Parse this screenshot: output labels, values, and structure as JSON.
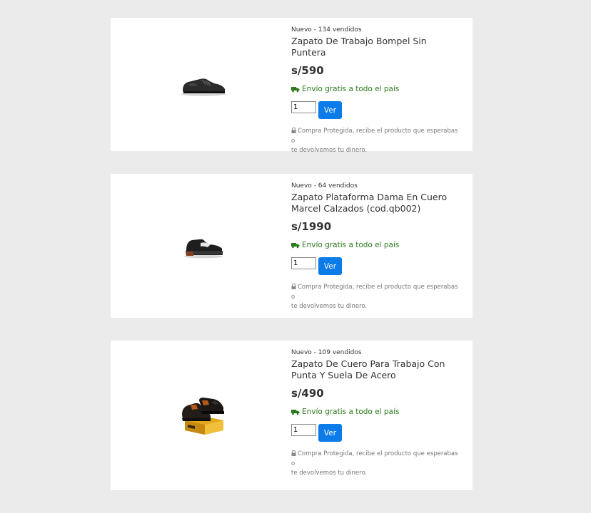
{
  "products": [
    {
      "meta": "Nuevo - 134 vendidos",
      "title_line1": "Zapato De Trabajo Bompel Sin Puntera",
      "title_line2": "",
      "price": "s/590",
      "shipping": "Envío gratis a todo el país",
      "qty": "1",
      "button": "Ver",
      "protect_line1": "Compra Protegida, recibe el producto que esperabas o",
      "protect_line2": "te devolvemos tu dinero.",
      "image": "black-work-shoe"
    },
    {
      "meta": "Nuevo - 64 vendidos",
      "title_line1": "Zapato Plataforma Dama En Cuero",
      "title_line2": "Marcel Calzados (cod.qb002)",
      "price": "s/1990",
      "shipping": "Envío gratis a todo el país",
      "qty": "1",
      "button": "Ver",
      "protect_line1": "Compra Protegida, recibe el producto que esperabas o",
      "protect_line2": "te devolvemos tu dinero.",
      "image": "platform-shoe"
    },
    {
      "meta": "Nuevo - 109 vendidos",
      "title_line1": "Zapato De Cuero Para Trabajo Con",
      "title_line2": "Punta Y Suela De Acero",
      "price": "s/490",
      "shipping": "Envío gratis a todo el país",
      "qty": "1",
      "button": "Ver",
      "protect_line1": "Compra Protegida, recibe el producto que esperabas o",
      "protect_line2": "te devolvemos tu dinero.",
      "image": "safety-boot-with-box"
    }
  ],
  "colors": {
    "background": "#ebebeb",
    "card": "#ffffff",
    "button": "#0d7be8",
    "shipping": "#2a7a1c",
    "muted": "#777777"
  }
}
